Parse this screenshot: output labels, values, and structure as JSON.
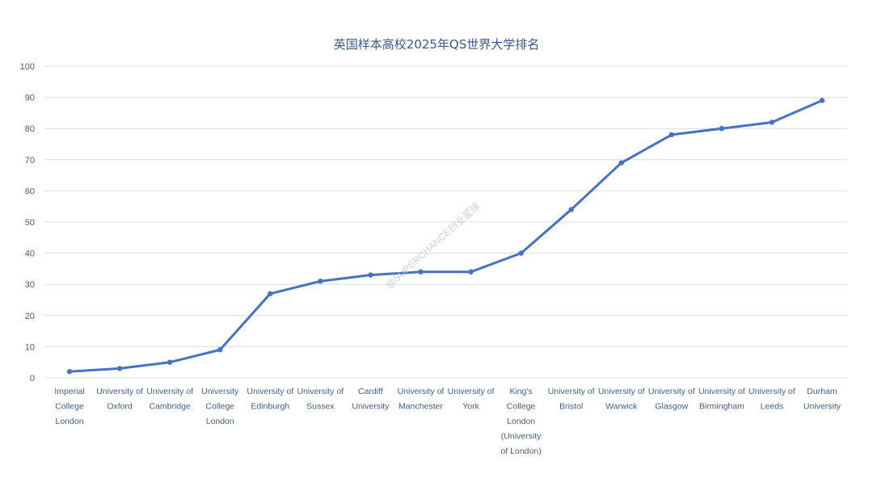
{
  "chart_data": {
    "type": "line",
    "title": "英国样本高校2025年QS世界大学排名",
    "xlabel": "",
    "ylabel": "",
    "ylim": [
      0,
      100
    ],
    "yticks": [
      0,
      10,
      20,
      30,
      40,
      50,
      60,
      70,
      80,
      90,
      100
    ],
    "grid": true,
    "legend": "none",
    "categories": [
      "Imperial College London",
      "University of Oxford",
      "University of Cambridge",
      "University College London",
      "University of Edinburgh",
      "University of Sussex",
      "Cardiff University",
      "University of Manchester",
      "University of York",
      "King's College London (University of London)",
      "University of Bristol",
      "University of Warwick",
      "University of Glasgow",
      "University of Birmingham",
      "University of Leeds",
      "Durham University"
    ],
    "series": [
      {
        "values": [
          2,
          3,
          5,
          9,
          27,
          31,
          33,
          34,
          34,
          40,
          54,
          69,
          78,
          80,
          82,
          89
        ]
      }
    ],
    "colors": {
      "line": "#4472c4",
      "grid": "#dcdcdc",
      "text": "#3f5f8a"
    }
  },
  "watermark": "@SUPERCHANCE创业星球"
}
